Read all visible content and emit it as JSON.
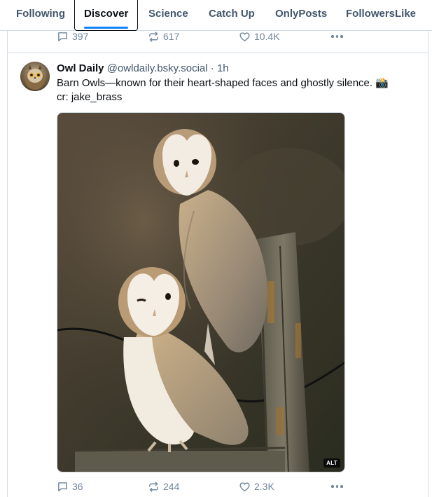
{
  "tabs": [
    {
      "label": "Following",
      "active": false
    },
    {
      "label": "Discover",
      "active": true
    },
    {
      "label": "Science",
      "active": false
    },
    {
      "label": "Catch Up",
      "active": false
    },
    {
      "label": "OnlyPosts",
      "active": false
    },
    {
      "label": "FollowersLike",
      "active": false
    }
  ],
  "colors": {
    "accent": "#1083fe",
    "muted": "#6f869f",
    "border": "#d4dbe2"
  },
  "previous_post": {
    "replies": "397",
    "reposts": "617",
    "likes": "10.4K"
  },
  "post": {
    "author_name": "Owl Daily",
    "author_handle": "@owldaily.bsky.social",
    "separator": "·",
    "time": "1h",
    "text_line1": "Barn Owls—known for their heart-shaped faces and ghostly silence. 📸",
    "text_line2": "cr: jake_brass",
    "image_alt_badge": "ALT",
    "replies": "36",
    "reposts": "244",
    "likes": "2.3K"
  },
  "icons": {
    "reply": "speech-bubble-icon",
    "repost": "repost-arrows-icon",
    "like": "heart-icon",
    "more": "more-dots-icon"
  }
}
